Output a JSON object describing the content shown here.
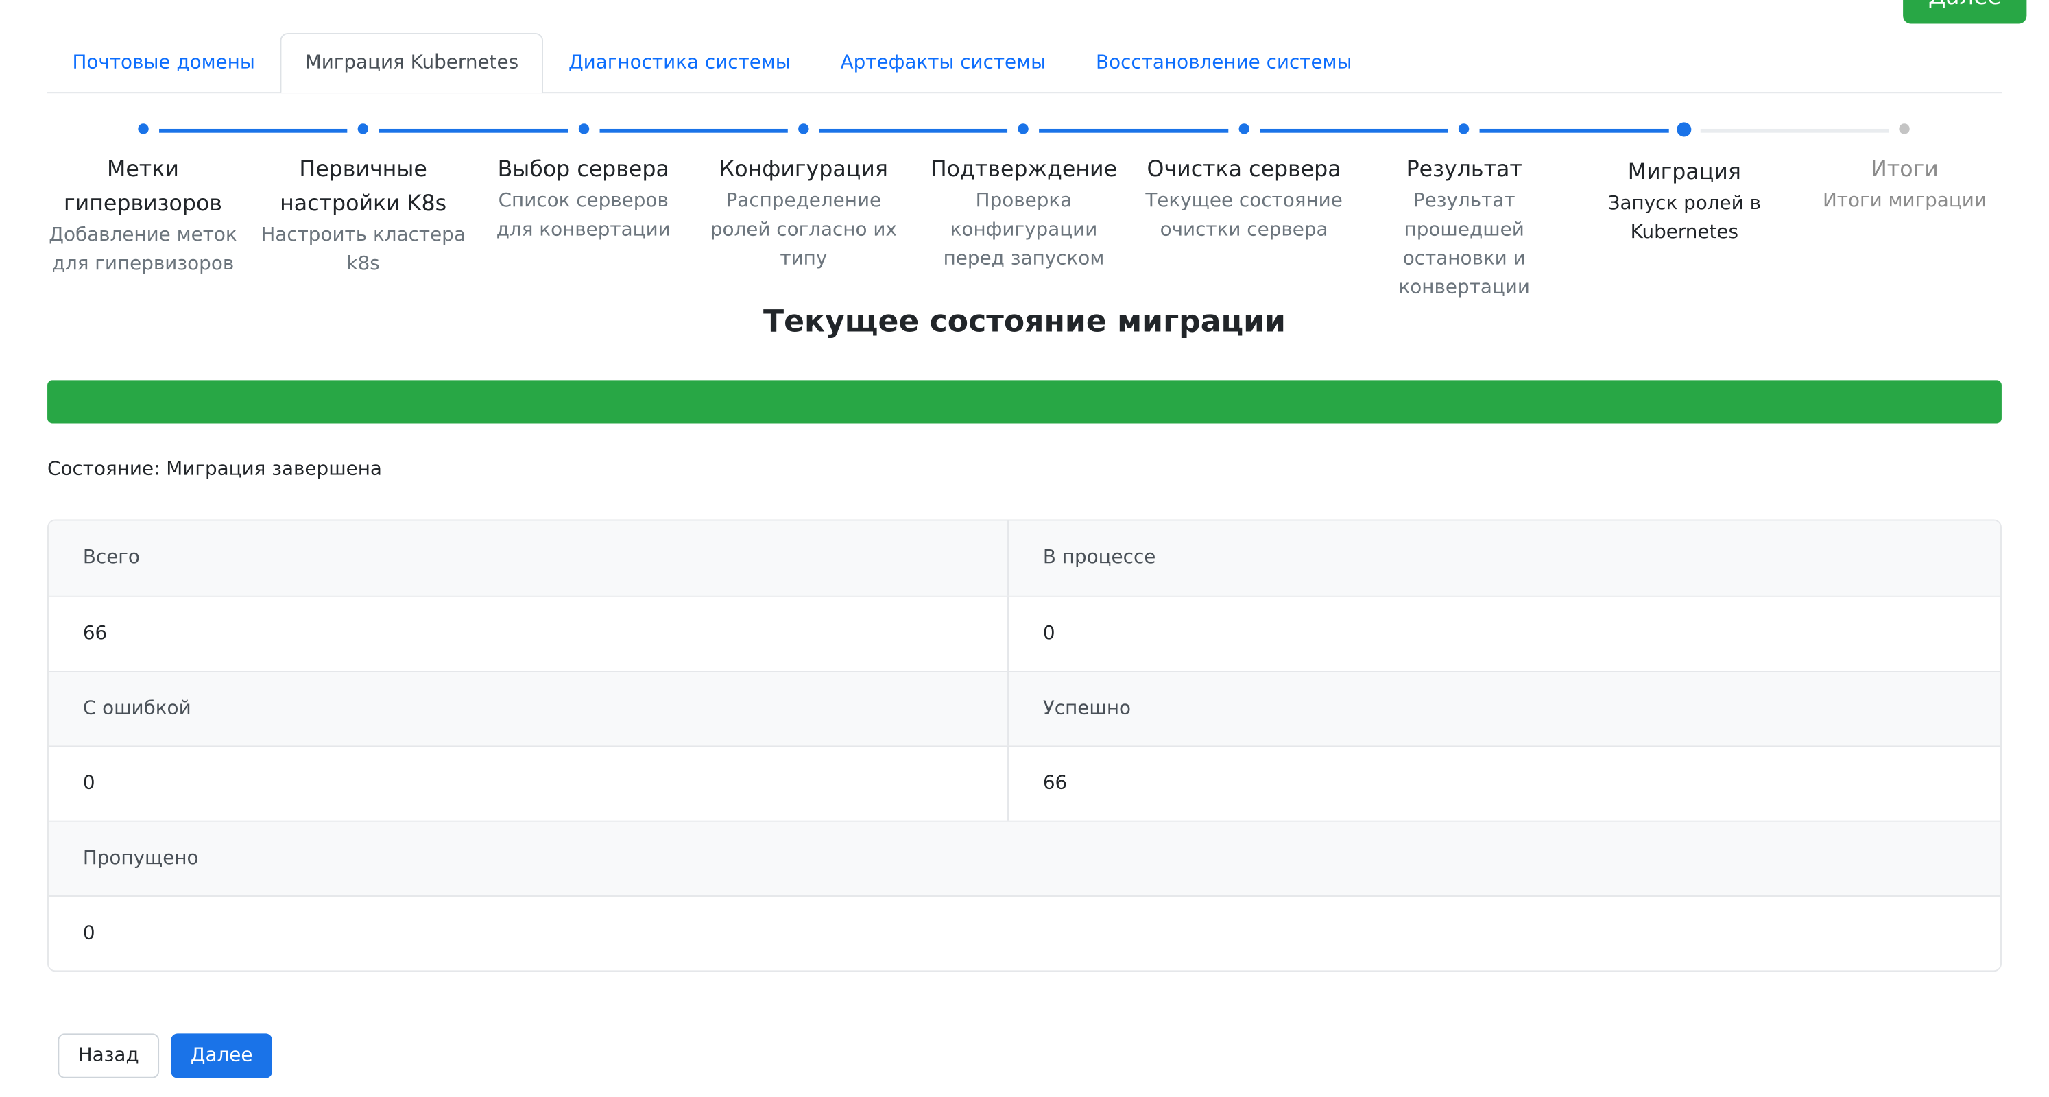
{
  "header": {
    "next_label": "Далее"
  },
  "tabs": [
    {
      "label": "Почтовые домены",
      "active": false
    },
    {
      "label": "Миграция Kubernetes",
      "active": true
    },
    {
      "label": "Диагностика системы",
      "active": false
    },
    {
      "label": "Артефакты системы",
      "active": false
    },
    {
      "label": "Восстановление системы",
      "active": false
    }
  ],
  "steps": [
    {
      "title": "Метки гипервизоров",
      "desc": "Добавление меток для гипервизоров",
      "state": "done"
    },
    {
      "title": "Первичные настройки K8s",
      "desc": "Настроить кластера k8s",
      "state": "done"
    },
    {
      "title": "Выбор сервера",
      "desc": "Список серверов для конвертации",
      "state": "done"
    },
    {
      "title": "Конфигурация",
      "desc": "Распределение ролей согласно их типу",
      "state": "done"
    },
    {
      "title": "Подтверждение",
      "desc": "Проверка конфигурации перед запуском",
      "state": "done"
    },
    {
      "title": "Очистка сервера",
      "desc": "Текущее состояние очистки сервера",
      "state": "done"
    },
    {
      "title": "Результат",
      "desc": "Результат прошедшей остановки и конвертации",
      "state": "done"
    },
    {
      "title": "Миграция",
      "desc": "Запуск ролей в Kubernetes",
      "state": "current"
    },
    {
      "title": "Итоги",
      "desc": "Итоги миграции",
      "state": "pending"
    }
  ],
  "main": {
    "heading": "Текущее состояние миграции",
    "progress_percent": 100,
    "status_text": "Состояние: Миграция завершена"
  },
  "stats": {
    "total_label": "Всего",
    "total_value": "66",
    "in_progress_label": "В процессе",
    "in_progress_value": "0",
    "error_label": "С ошибкой",
    "error_value": "0",
    "success_label": "Успешно",
    "success_value": "66",
    "skipped_label": "Пропущено",
    "skipped_value": "0"
  },
  "footer": {
    "back_label": "Назад",
    "next_label": "Далее"
  },
  "colors": {
    "accent": "#1a73e8",
    "success": "#28a745",
    "pending": "#c4c4c4"
  }
}
